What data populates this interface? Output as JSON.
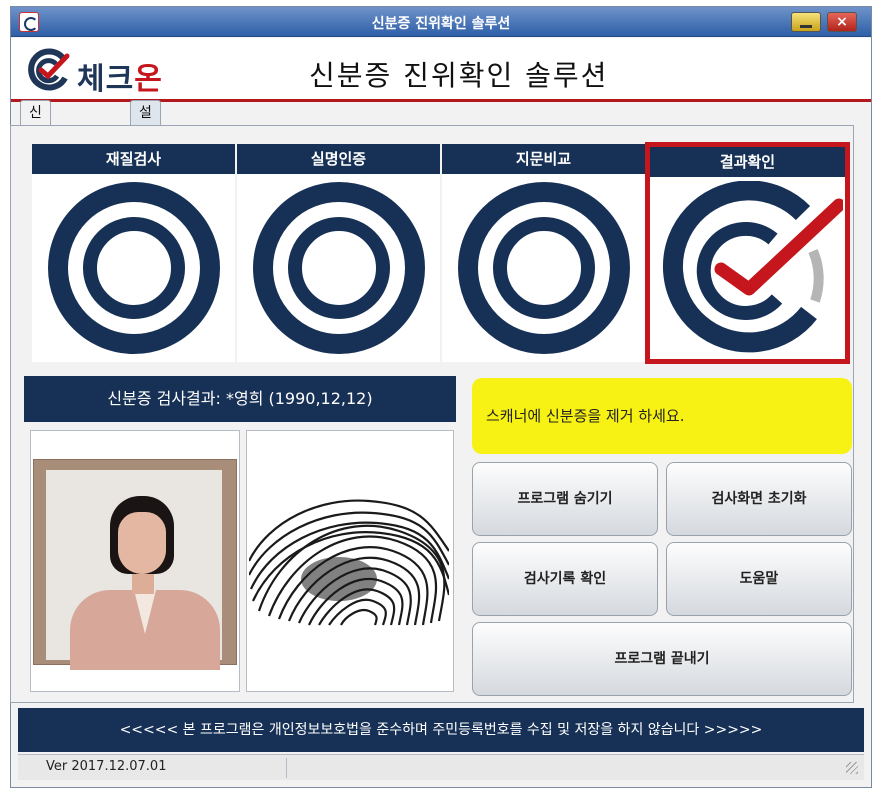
{
  "window": {
    "title": "신분증 진위확인 솔루션",
    "close_glyph": "×"
  },
  "header": {
    "logo_text": "체크",
    "logo_text_red": "온",
    "title": "신분증 진위확인 솔루션"
  },
  "tabs": [
    {
      "label": "신분증검사",
      "active": true
    },
    {
      "label": "설정",
      "active": false
    }
  ],
  "steps": [
    {
      "label": "재질검사",
      "icon": "ring-icon"
    },
    {
      "label": "실명인증",
      "icon": "ring-icon"
    },
    {
      "label": "지문비교",
      "icon": "ring-icon"
    },
    {
      "label": "결과확인",
      "icon": "check-logo-icon",
      "current": true
    }
  ],
  "result": {
    "text": "신분증 검사결과: *영희 (1990,12,12)"
  },
  "message": "스캐너에 신분증을 제거 하세요.",
  "buttons": {
    "hide": "프로그램 숨기기",
    "reset": "검사화면 초기화",
    "history": "검사기록 확인",
    "help": "도움말",
    "exit": "프로그램 끝내기"
  },
  "notice": "<<<<< 본 프로그램은 개인정보보호법을 준수하며 주민등록번호를 수집 및 저장을 하지 않습니다 >>>>>",
  "status": {
    "version": "Ver 2017.12.07.01"
  },
  "colors": {
    "navy": "#173156",
    "brand_red": "#c4161c",
    "message_yellow": "#f7f214"
  }
}
